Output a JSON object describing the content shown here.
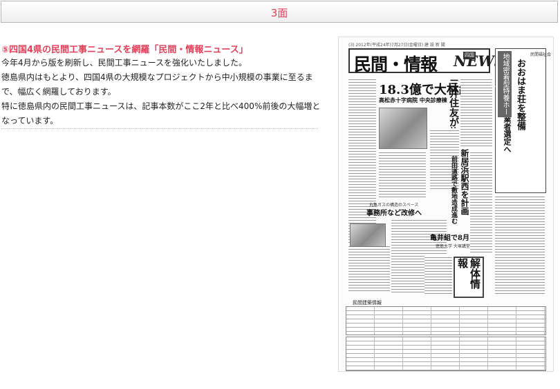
{
  "section_title": "3面",
  "article": {
    "heading": "⑤四国4県の民間工事ニュースを網羅「民間・情報ニュース」",
    "paragraphs": [
      "今年4月から版を刷新し、民間工事ニュースを強化いたしました。",
      "徳島県内はもとより、四国4県の大規模なプロジェクトから中小規模の事業に至るまで、幅広く網羅しております。",
      "特に徳島県内の民間工事ニュースは、記事本数がここ2年と比べ400%前後の大幅増となっています。"
    ]
  },
  "newspaper": {
    "masthead": "民間・情報",
    "masthead_news": "NEWS",
    "masthead_badge": "四国",
    "topline": "(3)   2012年(平成24年)7月27日(金曜日)   建 設 新 聞",
    "right_tab": "地域密着型特養ホーム",
    "right_tag": "民間福祉会",
    "right_headline_1": "おおはま荘を整備",
    "right_headline_2": "これから設計業者選定へ",
    "main_headline": "18.3億で大林組に",
    "main_subhead": "高松赤十字病院 中央診療棟",
    "second_headline": "三井住友が施工",
    "third_headline": "新居浜駅西を計画",
    "third_sub": "前田道路で敷地造成進む",
    "fourth_headline": "事務所など改修へ",
    "fourth_caption": "丸亀ガスの構造のスペース",
    "fifth_headline": "亀井組で8月",
    "fifth_sub": "徳島大学 大塚講堂",
    "kaitai": "解体情報",
    "table_title": "民間建築情報"
  }
}
